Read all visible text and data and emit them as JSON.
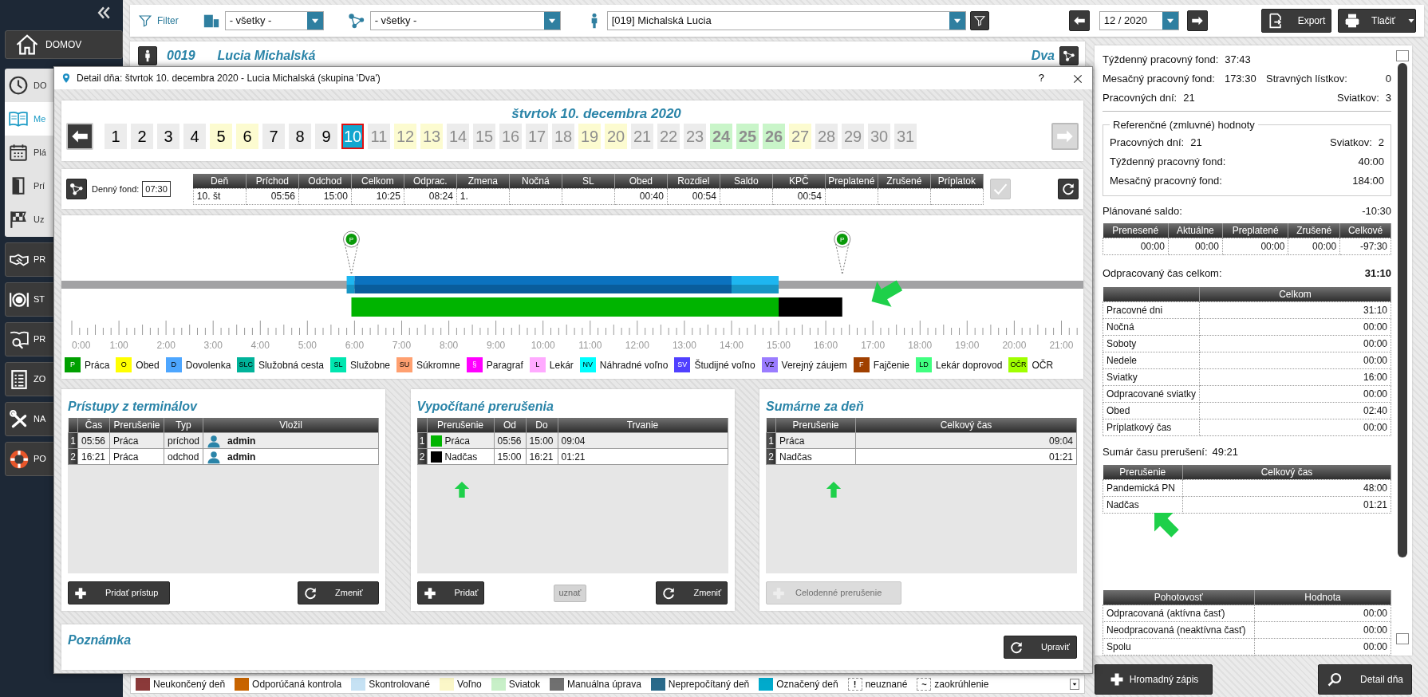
{
  "sidebar": {
    "home": "DOMOV",
    "submenu": [
      {
        "label": "DO",
        "selected": false
      },
      {
        "label": "Me",
        "selected": true
      },
      {
        "label": "Plá",
        "selected": false
      },
      {
        "label": "Prí",
        "selected": false
      },
      {
        "label": "Uz",
        "selected": false
      }
    ],
    "sections": [
      {
        "label": "PR"
      },
      {
        "label": "ST"
      },
      {
        "label": "PR"
      },
      {
        "label": "ZO"
      },
      {
        "label": "NA"
      },
      {
        "label": "PO"
      }
    ]
  },
  "toolbar": {
    "filter_label": "Filter",
    "location_select": "- všetky -",
    "group_select": "- všetky -",
    "employee_select": "[019] Michalská Lucia",
    "month_select": "12 / 2020",
    "export_button": "Export",
    "print_button": "Tlačiť"
  },
  "employee_header": {
    "number": "0019",
    "name": "Lucia Michalská",
    "group": "Dva"
  },
  "dialog": {
    "title": "Detail dňa: štvrtok 10. decembra 2020 -  Lucia Michalská  (skupina 'Dva')",
    "help": "?",
    "date_heading": "štvrtok 10. decembra 2020",
    "days": [
      {
        "label": "1",
        "kind": "workday",
        "disabled": false,
        "selected": false
      },
      {
        "label": "2",
        "kind": "workday",
        "disabled": false,
        "selected": false
      },
      {
        "label": "3",
        "kind": "workday",
        "disabled": false,
        "selected": false
      },
      {
        "label": "4",
        "kind": "workday",
        "disabled": false,
        "selected": false
      },
      {
        "label": "5",
        "kind": "weekend",
        "disabled": false,
        "selected": false
      },
      {
        "label": "6",
        "kind": "weekend",
        "disabled": false,
        "selected": false
      },
      {
        "label": "7",
        "kind": "workday",
        "disabled": false,
        "selected": false
      },
      {
        "label": "8",
        "kind": "workday",
        "disabled": false,
        "selected": false
      },
      {
        "label": "9",
        "kind": "workday",
        "disabled": false,
        "selected": false
      },
      {
        "label": "10",
        "kind": "workday",
        "disabled": false,
        "selected": true
      },
      {
        "label": "11",
        "kind": "workday",
        "disabled": true,
        "selected": false
      },
      {
        "label": "12",
        "kind": "weekend",
        "disabled": true,
        "selected": false
      },
      {
        "label": "13",
        "kind": "weekend",
        "disabled": true,
        "selected": false
      },
      {
        "label": "14",
        "kind": "workday",
        "disabled": true,
        "selected": false
      },
      {
        "label": "15",
        "kind": "workday",
        "disabled": true,
        "selected": false
      },
      {
        "label": "16",
        "kind": "workday",
        "disabled": true,
        "selected": false
      },
      {
        "label": "17",
        "kind": "workday",
        "disabled": true,
        "selected": false
      },
      {
        "label": "18",
        "kind": "workday",
        "disabled": true,
        "selected": false
      },
      {
        "label": "19",
        "kind": "weekend",
        "disabled": true,
        "selected": false
      },
      {
        "label": "20",
        "kind": "weekend",
        "disabled": true,
        "selected": false
      },
      {
        "label": "21",
        "kind": "workday",
        "disabled": true,
        "selected": false
      },
      {
        "label": "22",
        "kind": "workday",
        "disabled": true,
        "selected": false
      },
      {
        "label": "23",
        "kind": "workday",
        "disabled": true,
        "selected": false
      },
      {
        "label": "24",
        "kind": "holiday",
        "disabled": true,
        "selected": false
      },
      {
        "label": "25",
        "kind": "holiday",
        "disabled": true,
        "selected": false
      },
      {
        "label": "26",
        "kind": "holiday",
        "disabled": true,
        "selected": false
      },
      {
        "label": "27",
        "kind": "weekend",
        "disabled": true,
        "selected": false
      },
      {
        "label": "28",
        "kind": "workday",
        "disabled": true,
        "selected": false
      },
      {
        "label": "29",
        "kind": "workday",
        "disabled": true,
        "selected": false
      },
      {
        "label": "30",
        "kind": "workday",
        "disabled": true,
        "selected": false
      },
      {
        "label": "31",
        "kind": "workday",
        "disabled": true,
        "selected": false
      }
    ],
    "next_day": {
      "disabled": true
    },
    "daily_fund": {
      "label": "Denný fond:",
      "value": "07:30",
      "columns": [
        {
          "label": "Deň",
          "value": "10. št"
        },
        {
          "label": "Príchod",
          "value": "05:56"
        },
        {
          "label": "Odchod",
          "value": "15:00"
        },
        {
          "label": "Celkom",
          "value": "10:25"
        },
        {
          "label": "Odprac.",
          "value": "08:24"
        },
        {
          "label": "Zmena",
          "value": "1."
        },
        {
          "label": "Nočná"
        },
        {
          "label": "SL"
        },
        {
          "label": "Obed",
          "value": "00:40"
        },
        {
          "label": "Rozdiel",
          "value": "00:54"
        },
        {
          "label": "Saldo"
        },
        {
          "label": "KPČ",
          "value": "00:54"
        },
        {
          "label": "Preplatené"
        },
        {
          "label": "Zrušené"
        },
        {
          "label": "Príplatok"
        }
      ],
      "confirm": {
        "disabled": true
      }
    },
    "timeline": {
      "pins": [
        {
          "label": "P"
        },
        {
          "label": "P"
        }
      ],
      "hour_labels": [
        "0:00",
        "1:00",
        "2:00",
        "3:00",
        "4:00",
        "5:00",
        "6:00",
        "7:00",
        "8:00",
        "9:00",
        "10:00",
        "11:00",
        "12:00",
        "13:00",
        "14:00",
        "15:00",
        "16:00",
        "17:00",
        "18:00",
        "19:00",
        "20:00",
        "21:00"
      ],
      "legend": [
        {
          "code": "P",
          "label": "Práca",
          "color": "#00a000"
        },
        {
          "code": "O",
          "label": "Obed",
          "color": "#ffff00"
        },
        {
          "code": "D",
          "label": "Dovolenka",
          "color": "#4da6ff"
        },
        {
          "code": "SLC",
          "label": "Služobná cesta",
          "color": "#00b39a"
        },
        {
          "code": "SL",
          "label": "Služobne",
          "color": "#00e6b0"
        },
        {
          "code": "SU",
          "label": "Súkromne",
          "color": "#ffa070"
        },
        {
          "code": "§",
          "label": "Paragraf",
          "color": "#ff00ff"
        },
        {
          "code": "L",
          "label": "Lekár",
          "color": "#ffaaff"
        },
        {
          "code": "NV",
          "label": "Náhradné voľno",
          "color": "#00ffff"
        },
        {
          "code": "SV",
          "label": "Študijné voľno",
          "color": "#5040ff"
        },
        {
          "code": "VZ",
          "label": "Verejný záujem",
          "color": "#9a7cff"
        },
        {
          "code": "F",
          "label": "Fajčenie",
          "color": "#a04000"
        },
        {
          "code": "LD",
          "label": "Lekár doprovod",
          "color": "#40ff80"
        },
        {
          "code": "OČR",
          "label": "OČR",
          "color": "#a0ff00"
        }
      ]
    },
    "terminal_access": {
      "title": "Prístupy z terminálov",
      "columns": [
        "Čas",
        "Prerušenie",
        "Typ",
        "Vložil"
      ],
      "rows": [
        {
          "number": "1",
          "time": "05:56",
          "interruption": "Práca",
          "type": "príchod",
          "user": "admin"
        },
        {
          "number": "2",
          "time": "16:21",
          "interruption": "Práca",
          "type": "odchod",
          "user": "admin"
        }
      ],
      "add_button": "Pridať prístup",
      "change_button": "Zmeniť"
    },
    "computed_interruptions": {
      "title": "Vypočítané prerušenia",
      "columns": [
        "Prerušenie",
        "Od",
        "Do",
        "Trvanie"
      ],
      "rows": [
        {
          "number": "1",
          "name": "Práca",
          "color": "#00b400",
          "from": "05:56",
          "to": "15:00",
          "duration": "09:04"
        },
        {
          "number": "2",
          "name": "Nadčas",
          "color": "#000000",
          "from": "15:00",
          "to": "16:21",
          "duration": "01:21"
        }
      ],
      "add_button": "Pridať",
      "accept_button": {
        "label": "uznať",
        "disabled": true
      },
      "change_button": "Zmeniť"
    },
    "day_summary": {
      "title": "Sumárne za deň",
      "columns": [
        "Prerušenie",
        "Celkový čas"
      ],
      "rows": [
        {
          "number": "1",
          "name": "Práca",
          "total": "09:04"
        },
        {
          "number": "2",
          "name": "Nadčas",
          "total": "01:21"
        }
      ],
      "full_day_button": {
        "label": "Celodenné prerušenie",
        "disabled": true
      }
    },
    "note": {
      "title": "Poznámka",
      "edit_button": "Upraviť"
    }
  },
  "right_panel": {
    "weekly_fund": {
      "label": "Týždenný pracovný fond:",
      "value": "37:43"
    },
    "monthly_fund": {
      "label": "Mesačný pracovný fond:",
      "value": "173:30"
    },
    "meal_tickets": {
      "label": "Stravných lístkov:",
      "value": "0"
    },
    "working_days": {
      "label": "Pracovných dní:",
      "value": "21"
    },
    "holidays": {
      "label": "Sviatkov:",
      "value": "3"
    },
    "reference": {
      "title": "Referenčné (zmluvné) hodnoty",
      "working_days": {
        "label": "Pracovných dní:",
        "value": "21"
      },
      "holidays": {
        "label": "Sviatkov:",
        "value": "2"
      },
      "weekly_fund": {
        "label": "Týždenný pracovný fond:",
        "value": "40:00"
      },
      "monthly_fund": {
        "label": "Mesačný pracovný fond:",
        "value": "184:00"
      }
    },
    "planned_balance": {
      "label": "Plánované saldo:",
      "value": "-10:30"
    },
    "balance_table": {
      "columns": [
        "Prenesené",
        "Aktuálne",
        "Preplatené",
        "Zrušené",
        "Celkové"
      ],
      "rows": [
        [
          "00:00",
          "00:00",
          "00:00",
          "00:00",
          "-97:30"
        ]
      ]
    },
    "worked_total": {
      "label": "Odpracovaný čas celkom:",
      "value": "31:10"
    },
    "worked_table": {
      "value_column": "Celkom",
      "rows": [
        [
          "Pracovné dni",
          "31:10"
        ],
        [
          "Nočná",
          "00:00"
        ],
        [
          "Soboty",
          "00:00"
        ],
        [
          "Nedele",
          "00:00"
        ],
        [
          "Sviatky",
          "16:00"
        ],
        [
          "Odpracované sviatky",
          "00:00"
        ],
        [
          "Obed",
          "02:40"
        ],
        [
          "Príplatkový čas",
          "00:00"
        ]
      ]
    },
    "interruption_total": {
      "label": "Sumár času prerušení:",
      "value": "49:21"
    },
    "interruption_table": {
      "columns": [
        "Prerušenie",
        "Celkový čas"
      ],
      "rows": [
        [
          "Pandemická PN",
          "48:00"
        ],
        [
          "Nadčas",
          "01:21"
        ]
      ]
    },
    "standby_table": {
      "columns": [
        "Pohotovosť",
        "Hodnota"
      ],
      "rows": [
        [
          "Odpracovaná (aktívna časť)",
          "00:00"
        ],
        [
          "Neodpracovaná (neaktívna časť)",
          "00:00"
        ],
        [
          "Spolu",
          "00:00"
        ]
      ]
    }
  },
  "bottom_legend": [
    {
      "label": "Neukončený deň",
      "kind": "swatch",
      "color": "#8b3a3a"
    },
    {
      "label": "Odporúčaná kontrola",
      "kind": "swatch",
      "color": "#c86400"
    },
    {
      "label": "Skontrolované",
      "kind": "swatch",
      "color": "#c6e2f4"
    },
    {
      "label": "Voľno",
      "kind": "swatch",
      "color": "#fbf7c8"
    },
    {
      "label": "Sviatok",
      "kind": "swatch",
      "color": "#c8f0c8"
    },
    {
      "label": "Manuálna úprava",
      "kind": "swatch",
      "color": "#707070"
    },
    {
      "label": "Neprepočítaný deň",
      "kind": "swatch",
      "color": "#2a6a8a"
    },
    {
      "label": "Označený deň",
      "kind": "swatch",
      "color": "#00aacc"
    },
    {
      "label": "neuznané",
      "kind": "symbol",
      "symbol": "!"
    },
    {
      "label": "zaokrúhlenie",
      "kind": "symbol",
      "symbol": "~"
    }
  ],
  "bottom_buttons": {
    "bulk_entry": "Hromadný zápis",
    "day_detail": "Detail dňa"
  }
}
